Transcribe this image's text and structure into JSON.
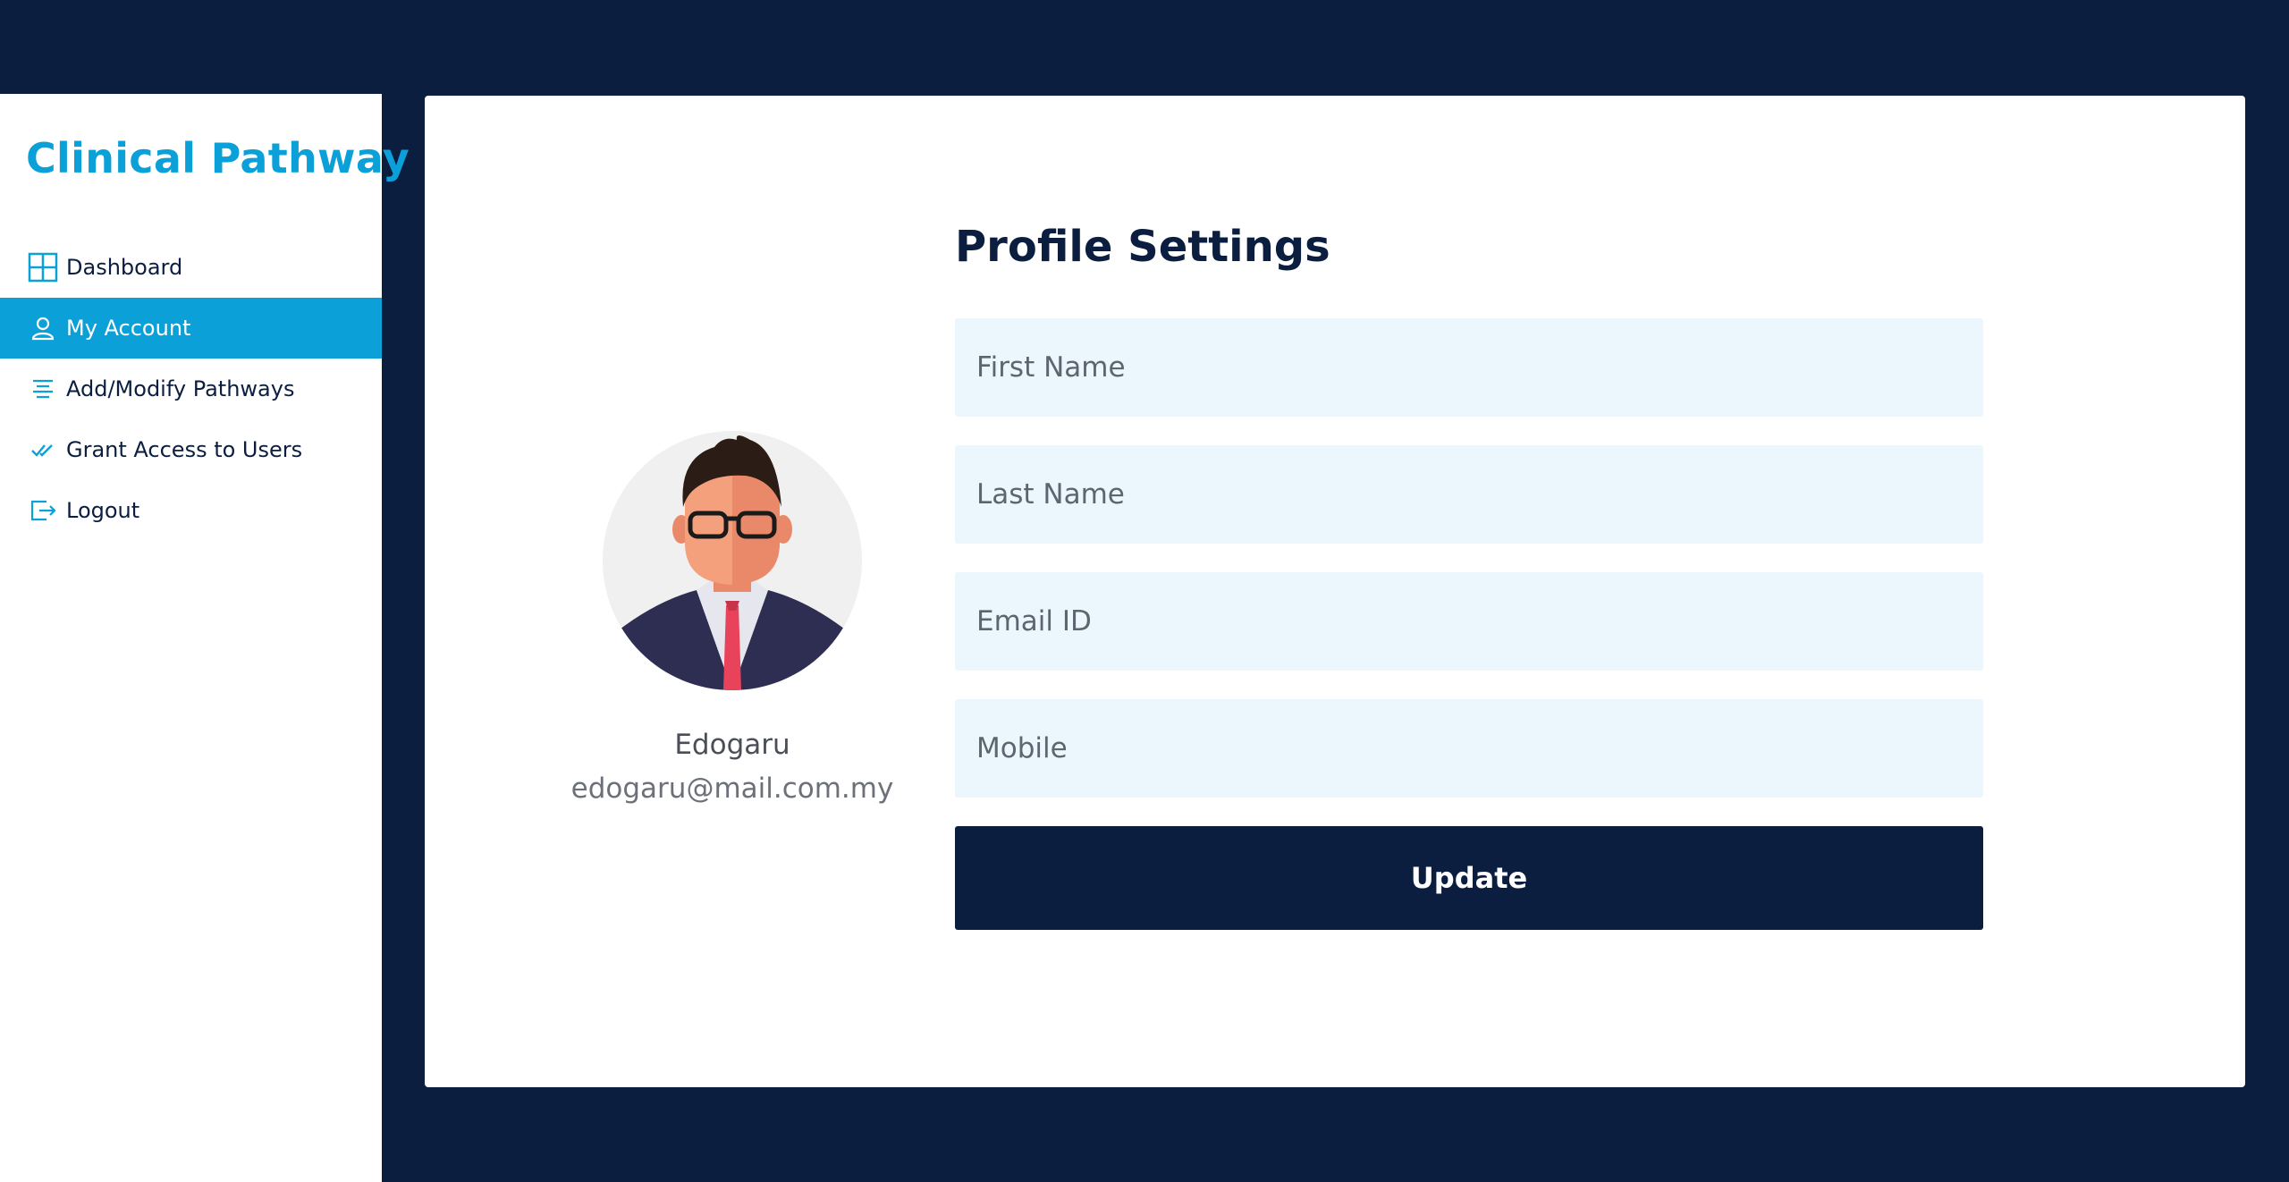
{
  "brand": "Clinical Pathway",
  "nav": [
    {
      "label": "Dashboard",
      "icon": "grid-icon",
      "active": false
    },
    {
      "label": "My Account",
      "icon": "user-icon",
      "active": true
    },
    {
      "label": "Add/Modify Pathways",
      "icon": "list-icon",
      "active": false
    },
    {
      "label": "Grant Access to Users",
      "icon": "double-check-icon",
      "active": false
    },
    {
      "label": "Logout",
      "icon": "logout-icon",
      "active": false
    }
  ],
  "profile": {
    "name": "Edogaru",
    "email": "edogaru@mail.com.my"
  },
  "form": {
    "title": "Profile Settings",
    "first_name_placeholder": "First Name",
    "last_name_placeholder": "Last Name",
    "email_placeholder": "Email ID",
    "mobile_placeholder": "Mobile",
    "update_label": "Update"
  },
  "colors": {
    "accent": "#0ba1d8",
    "navy": "#0b1e40",
    "field_bg": "#ecf7fd"
  }
}
